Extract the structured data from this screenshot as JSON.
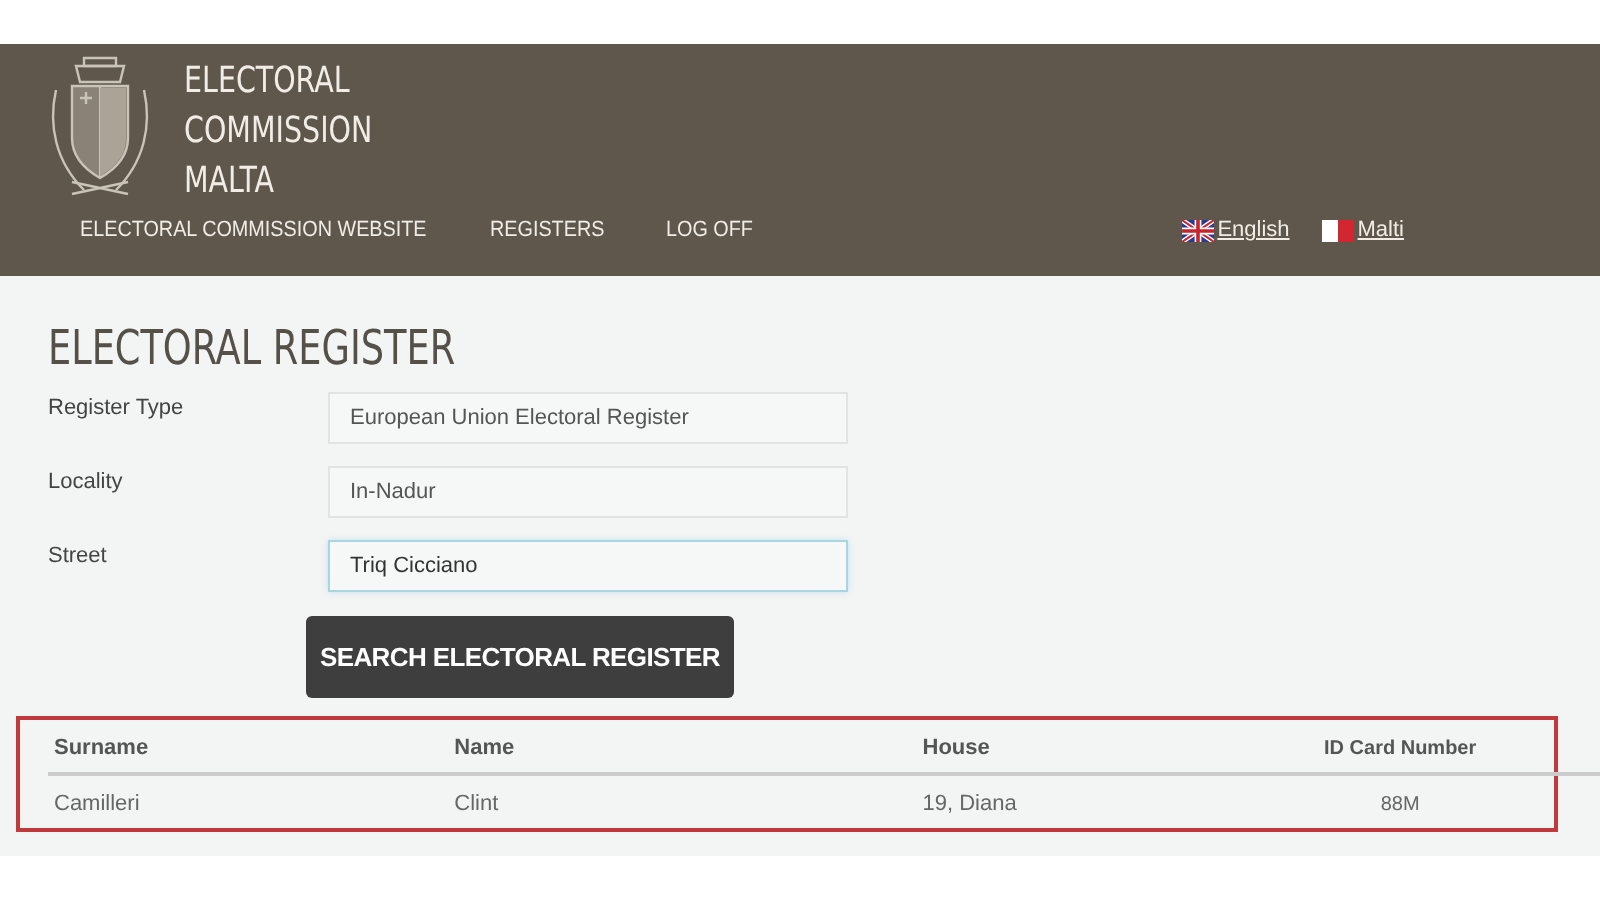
{
  "header": {
    "title_lines": [
      "ELECTORAL",
      "COMMISSION",
      "MALTA"
    ],
    "nav": [
      {
        "label": "ELECTORAL COMMISSION WEBSITE"
      },
      {
        "label": "REGISTERS"
      },
      {
        "label": "LOG OFF"
      }
    ],
    "languages": [
      {
        "label": "English",
        "kind": "uk"
      },
      {
        "label": "Malti",
        "kind": "mt"
      }
    ]
  },
  "page": {
    "heading": "ELECTORAL REGISTER",
    "fields": [
      {
        "label": "Register Type",
        "value": "European Union Electoral Register",
        "focused": false
      },
      {
        "label": "Locality",
        "value": "In-Nadur",
        "focused": false
      },
      {
        "label": "Street",
        "value": "Triq Cicciano",
        "focused": true
      }
    ],
    "search_button": "SEARCH ELECTORAL REGISTER"
  },
  "table": {
    "columns": [
      "Surname",
      "Name",
      "House",
      "ID Card Number"
    ],
    "rows": [
      [
        "Camilleri",
        "Clint",
        "19, Diana",
        "88M"
      ]
    ]
  }
}
